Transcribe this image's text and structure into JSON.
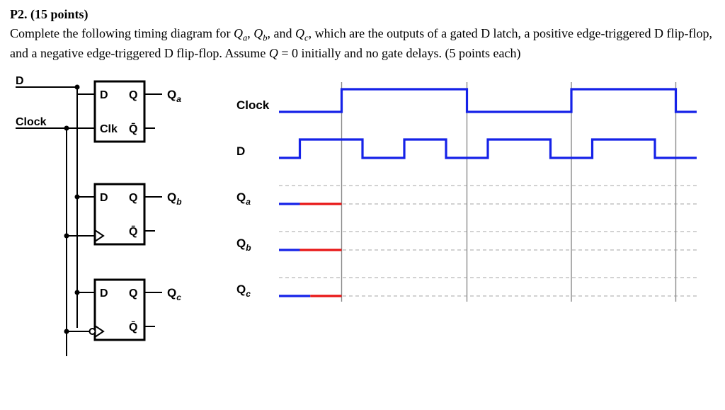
{
  "problem": {
    "title": "P2. (15 points)",
    "body_prefix": "Complete the following timing diagram for ",
    "qa": "Q",
    "qa_sub": "a",
    "comma1": ", ",
    "qb": "Q",
    "qb_sub": "b",
    "comma2": ", and ",
    "qc": "Q",
    "qc_sub": "c",
    "body_mid": ", which are the outputs of a gated D latch, a positive edge-triggered D flip-flop, and a negative edge-triggered D flip-flop. Assume ",
    "q_init": "Q",
    "eq_zero": " = 0 initially and no gate delays. (5 points each)"
  },
  "circuit": {
    "inputs": {
      "D": "D",
      "Clock": "Clock"
    },
    "latch": {
      "d": "D",
      "q": "Q",
      "clk": "Clk",
      "qbar": "Q̄",
      "out": "Q",
      "out_sub": "a"
    },
    "posedge": {
      "d": "D",
      "q": "Q",
      "qbar": "Q̄",
      "out": "Q",
      "out_sub": "b"
    },
    "negedge": {
      "d": "D",
      "q": "Q",
      "qbar": "Q̄",
      "out": "Q",
      "out_sub": "c"
    }
  },
  "timing": {
    "labels": {
      "clock": "Clock",
      "d": "D",
      "qa": "Q",
      "qa_sub": "a",
      "qb": "Q",
      "qb_sub": "b",
      "qc": "Q",
      "qc_sub": "c"
    }
  },
  "chart_data": {
    "type": "timing-diagram",
    "time_units": 20,
    "x_range": [
      0,
      20
    ],
    "clock_edges_rise": [
      3,
      14
    ],
    "clock_edges_fall": [
      9,
      19
    ],
    "signals": [
      {
        "name": "Clock",
        "color": "#1522e8",
        "levels": [
          [
            0,
            0
          ],
          [
            3,
            1
          ],
          [
            9,
            0
          ],
          [
            14,
            1
          ],
          [
            19,
            0
          ]
        ],
        "drawn_until": 20
      },
      {
        "name": "D",
        "color": "#1522e8",
        "levels": [
          [
            0,
            0
          ],
          [
            1,
            1
          ],
          [
            4,
            0
          ],
          [
            6,
            1
          ],
          [
            8,
            0
          ],
          [
            10,
            1
          ],
          [
            13,
            0
          ],
          [
            15,
            1
          ],
          [
            18,
            0
          ]
        ],
        "drawn_until": 20
      },
      {
        "name": "Qa",
        "color": "#e81515",
        "levels": [
          [
            0,
            0
          ]
        ],
        "drawn_until": 3,
        "initial_blue_flat_until": 1
      },
      {
        "name": "Qb",
        "color": "#e81515",
        "levels": [
          [
            0,
            0
          ]
        ],
        "drawn_until": 3,
        "initial_blue_flat_until": 1
      },
      {
        "name": "Qc",
        "color": "#e81515",
        "levels": [
          [
            0,
            0
          ]
        ],
        "drawn_until": 3,
        "initial_blue_flat_until": 1.5
      }
    ],
    "gridlines_vertical_at": [
      3,
      9,
      14,
      19
    ],
    "gridlines_horizontal_rows": [
      "Qa_top",
      "Qa_bot",
      "Qb_top",
      "Qb_bot",
      "Qc_top",
      "Qc_bot"
    ]
  }
}
